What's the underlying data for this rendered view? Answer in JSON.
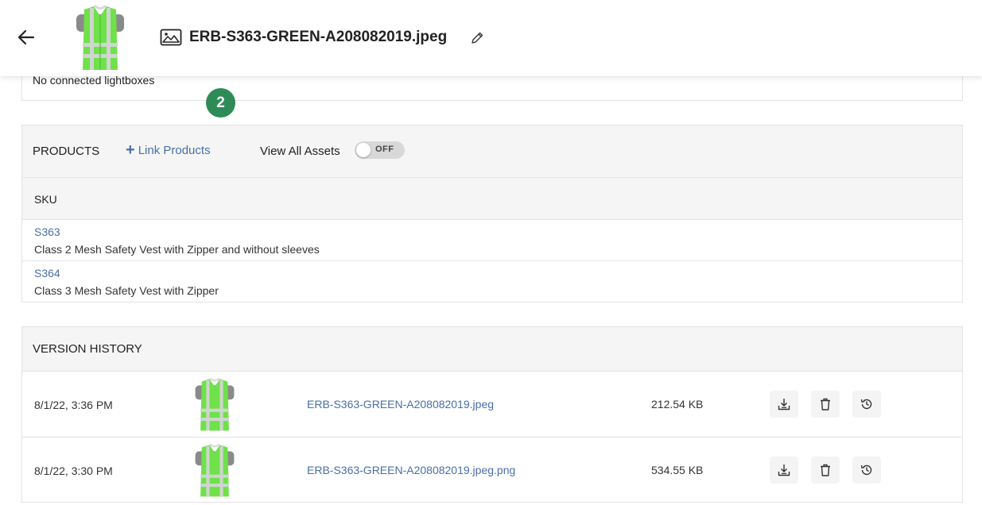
{
  "header": {
    "title": "ERB-S363-GREEN-A208082019.jpeg",
    "back_icon": "arrow-left-icon",
    "file_type_icon": "image-icon",
    "edit_icon": "pencil-icon",
    "thumb_colors": {
      "vest": "#6fe14a",
      "stripe": "#cfd5cf",
      "shirt": "#8a8a8a"
    }
  },
  "lightboxes": {
    "empty_text": "No connected lightboxes"
  },
  "step_badge": {
    "label": "2",
    "color": "#2e8b57"
  },
  "products": {
    "title": "PRODUCTS",
    "link_label": "Link Products",
    "view_all_label": "View All Assets",
    "toggle_state": "OFF",
    "column_header": "SKU",
    "items": [
      {
        "sku": "S363",
        "description": "Class 2 Mesh Safety Vest with Zipper and without sleeves"
      },
      {
        "sku": "S364",
        "description": "Class 3 Mesh Safety Vest with Zipper"
      }
    ]
  },
  "version_history": {
    "title": "VERSION HISTORY",
    "rows": [
      {
        "date": "8/1/22, 3:36 PM",
        "filename": "ERB-S363-GREEN-A208082019.jpeg",
        "size": "212.54 KB"
      },
      {
        "date": "8/1/22, 3:30 PM",
        "filename": "ERB-S363-GREEN-A208082019.jpeg.png",
        "size": "534.55 KB"
      }
    ],
    "actions": [
      "download-icon",
      "trash-icon",
      "history-icon"
    ]
  },
  "colors": {
    "link": "#4a6fa5",
    "panel_header_bg": "#f5f5f5",
    "border": "#e3e3e3"
  }
}
